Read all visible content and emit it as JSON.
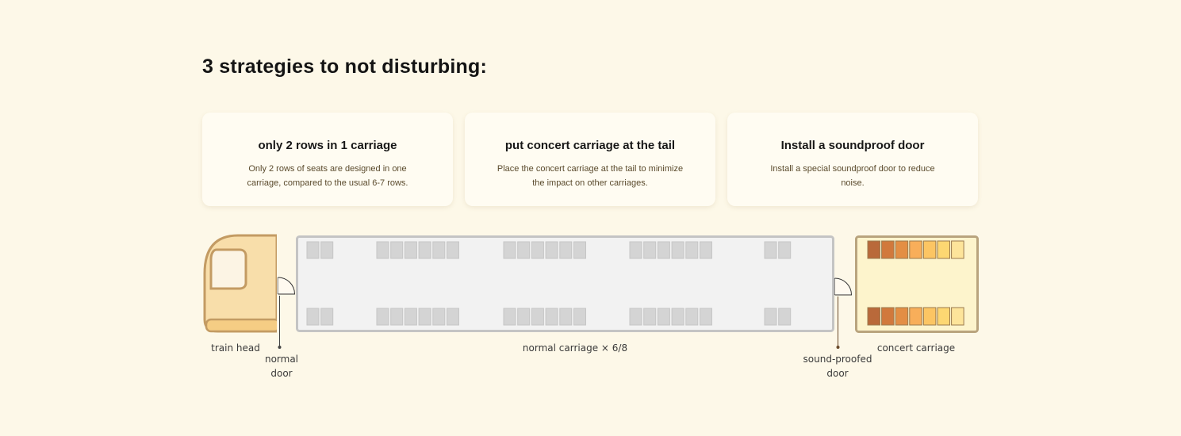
{
  "title": "3 strategies to not disturbing:",
  "cards": [
    {
      "title": "only 2 rows in 1 carriage",
      "description": "Only 2 rows of seats are designed in one carriage, compared to the usual 6-7 rows."
    },
    {
      "title": "put concert carriage at the tail",
      "description": "Place the concert carriage at the tail to minimize the impact on other carriages."
    },
    {
      "title": "Install a soundproof door",
      "description": "Install a special soundproof door to reduce noise."
    }
  ],
  "labels": {
    "train_head": "train head",
    "normal_door": "normal door",
    "normal_carriage": "normal carriage × 6/8",
    "soundproofed_door": "sound-proofed door",
    "concert_carriage": "concert carriage"
  },
  "colors": {
    "background": "#fdf8e8",
    "seat_gray": "#d4d4d4",
    "carriage_fill": "#f2f2f2",
    "carriage_border": "#c4c4c4",
    "concert_fill": "#fdf4cc",
    "concert_border": "#b9a47e",
    "head_fill": "#f8deaa",
    "head_border": "#c39b63",
    "concert_seats": [
      "#b9693a",
      "#d1793c",
      "#e38e44",
      "#f8ae5a",
      "#fcc563",
      "#fdd772",
      "#fde49a"
    ]
  },
  "icons": {
    "door": "door-swing-icon",
    "pointer": "pointer-dot-icon"
  }
}
